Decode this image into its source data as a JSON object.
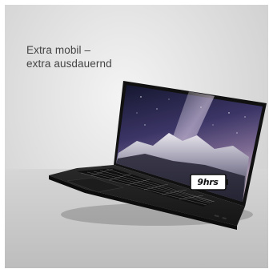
{
  "headline": {
    "line1": "Extra mobil –",
    "line2": "extra ausdauernd"
  },
  "battery_badge": {
    "text": "9hrs"
  },
  "colors": {
    "background": "#dcdcdc",
    "laptop_body": "#1f1f1f",
    "screen_sky_top": "#1b1d3a",
    "screen_sky_mid": "#6d5a86"
  },
  "image_subject": "laptop-with-battery-life-badge"
}
